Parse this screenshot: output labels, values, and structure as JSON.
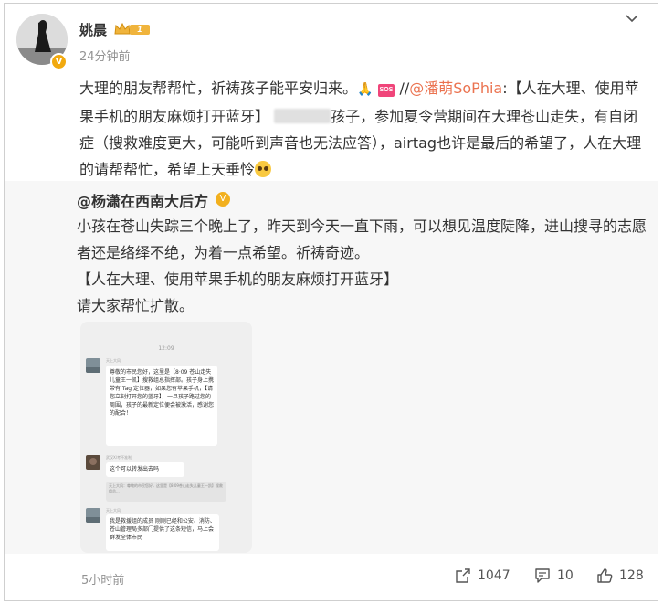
{
  "post": {
    "author": "姚晨",
    "level_badge": "1",
    "timestamp": "24分钟前",
    "avatar_badge_icon": "V",
    "text_before": "大理的朋友帮帮忙，祈祷孩子能平安归来。",
    "pray_icon": "🙏",
    "sos_label": "SOS",
    "separator": "//",
    "mention": "@潘萌SoPhia",
    "text_after_mention": ":【人在大理、使用苹果手机的朋友麻烦打开蓝牙】",
    "text_after_redacted": "孩子，参加夏令营期间在大理苍山走失，有自闭症（搜救难度更大，可能听到声音也无法应答），airtag也许是最后的希望了，人在大理的请帮帮忙，希望上天垂怜"
  },
  "repost": {
    "author": "@杨潇在西南大后方",
    "verified_icon": "V",
    "lines": [
      "小孩在苍山失踪三个晚上了，昨天到今天一直下雨，可以想见温度陡降，进山搜寻的志愿者还是络绎不绝，为着一点希望。祈祷奇迹。",
      "【人在大理、使用苹果手机的朋友麻烦打开蓝牙】",
      "请大家帮忙扩散。"
    ]
  },
  "image": {
    "time": "12:09",
    "sender1": "天上大风",
    "msg1": "尊敬的市民您好，这里是【8·09 苍山走失儿童王一凯】搜救组总指挥部。孩子身上携带有 Tag 定位器，如果您有苹果手机，【请您立刻打开您的蓝牙】，一旦孩子路过您的周围，孩子的最新定位便会被激活，感谢您的配合！",
    "sender2": "武汉X/考不准啦",
    "msg2": "这个可以转发出去吗",
    "quote": "天上大风：尊敬的市民您好，这里是【8·09苍山走失儿童王一凯】搜救组总...",
    "sender3": "天上大风",
    "msg3": "我是救援组的成员 刚刚已经和公安、消防、苍山管理局多部门提供了这条短信，马上会群发全体市民"
  },
  "footer": {
    "time": "5小时前",
    "share_count": "1047",
    "comment_count": "10",
    "like_count": "128"
  },
  "colors": {
    "mention": "#eb7350",
    "repost_bg": "#f7f7f7",
    "badge_gold": "#f0b43c"
  }
}
